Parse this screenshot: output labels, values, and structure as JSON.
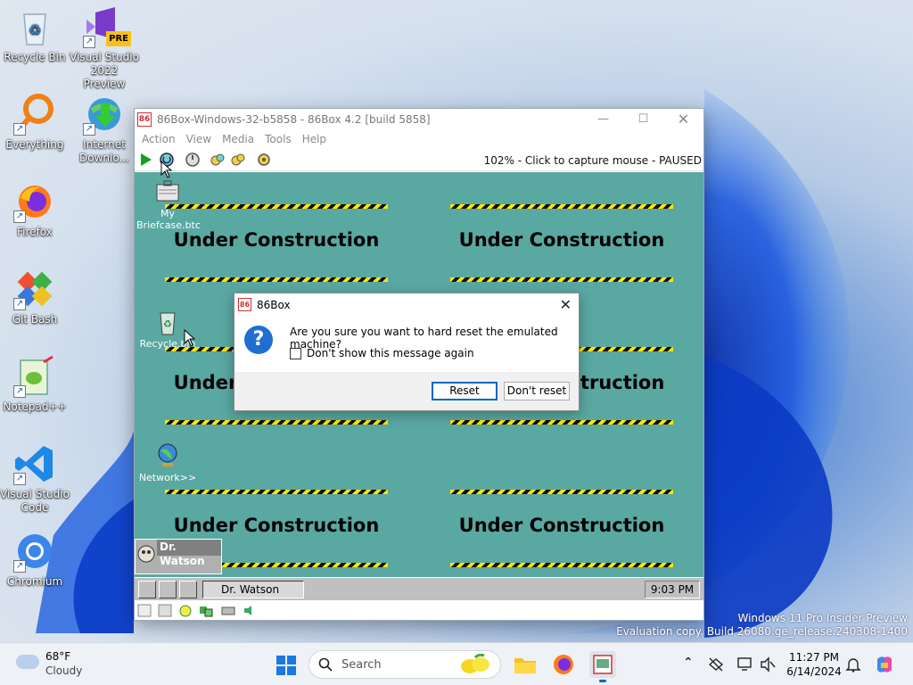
{
  "desktop": {
    "icons": [
      {
        "label": "Recycle Bin"
      },
      {
        "label": "Visual Studio 2022 Preview",
        "badge": "PRE"
      },
      {
        "label": "Everything"
      },
      {
        "label": "Internet Downlo..."
      },
      {
        "label": "Firefox"
      },
      {
        "label": "Git Bash"
      },
      {
        "label": "Notepad++"
      },
      {
        "label": "Visual Studio Code"
      },
      {
        "label": "Chromium"
      }
    ]
  },
  "box86": {
    "title": "86Box-Windows-32-b5858 - 86Box 4.2 [build 5858]",
    "icon_text": "86",
    "menu": [
      "Action",
      "View",
      "Media",
      "Tools",
      "Help"
    ],
    "status": "102% - Click to capture mouse - PAUSED",
    "emulated": {
      "banner_text": "Under Construction",
      "icons": [
        {
          "label": "My Briefcase.btc"
        },
        {
          "label": "Recycle.bin"
        },
        {
          "label": "Network>>"
        }
      ],
      "drwatson_title": "Dr. Watson",
      "task_label": "Dr. Watson",
      "clock": "9:03 PM"
    }
  },
  "dialog": {
    "title": "86Box",
    "icon_text": "86",
    "question_glyph": "?",
    "message": "Are you sure you want to hard reset the emulated machine?",
    "checkbox_label": "Don't show this message again",
    "reset_label": "Reset",
    "dont_reset_label": "Don't reset"
  },
  "watermark": {
    "line1": "Windows 11 Pro Insider Preview",
    "line2": "Evaluation copy. Build 26080.ge_release.240308-1400"
  },
  "taskbar": {
    "weather_temp": "68°F",
    "weather_cond": "Cloudy",
    "search_placeholder": "Search",
    "time": "11:27 PM",
    "date": "6/14/2024"
  },
  "colors": {
    "emu_bg": "#5aa8a2",
    "accent": "#0067c0",
    "stripe_yellow": "#ffe600"
  }
}
